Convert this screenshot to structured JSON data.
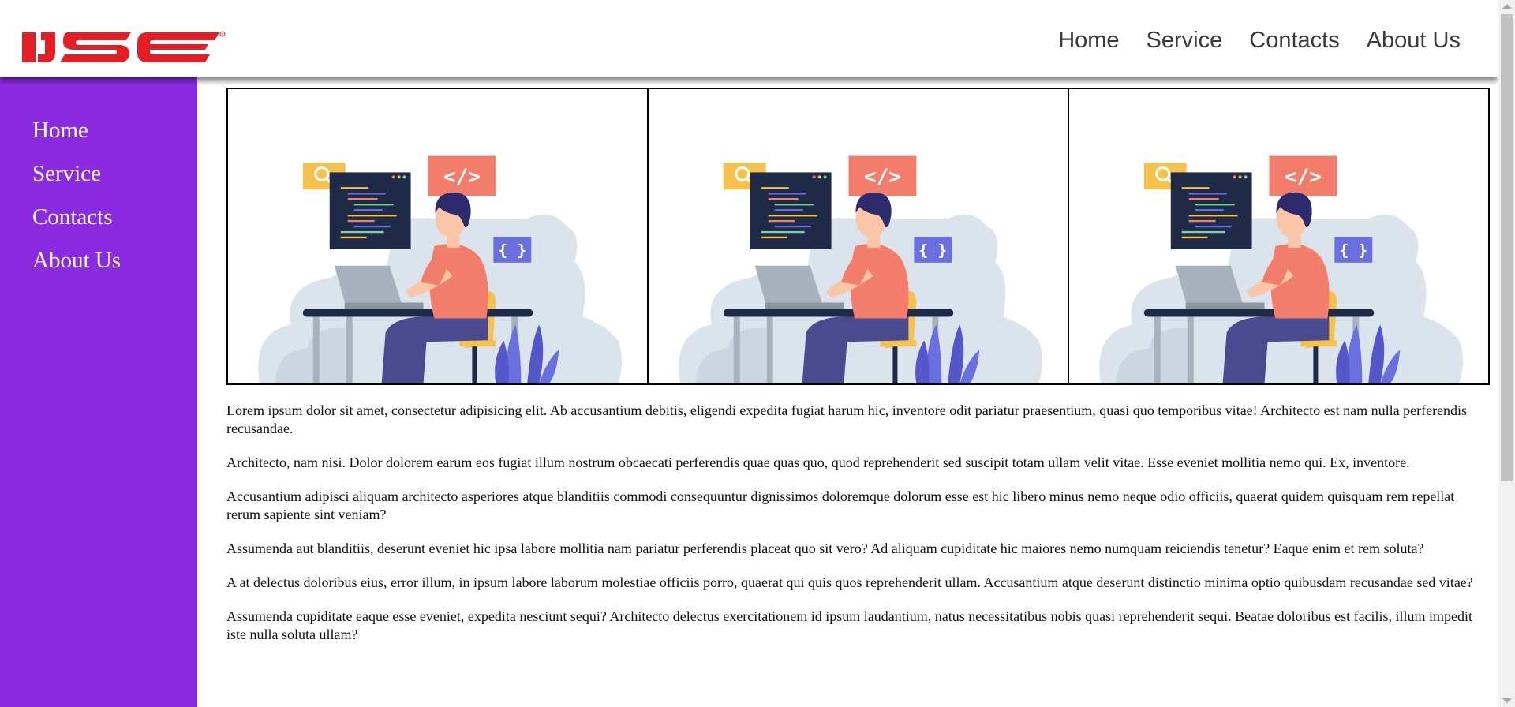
{
  "brand": {
    "logo_text": "IJSE"
  },
  "topnav": {
    "items": [
      {
        "label": "Home"
      },
      {
        "label": "Service"
      },
      {
        "label": "Contacts"
      },
      {
        "label": "About Us"
      }
    ]
  },
  "sidebar": {
    "items": [
      {
        "label": "Home"
      },
      {
        "label": "Service"
      },
      {
        "label": "Contacts"
      },
      {
        "label": "About Us"
      }
    ]
  },
  "gallery": {
    "images": [
      {
        "icon": "developer-illustration"
      },
      {
        "icon": "developer-illustration"
      },
      {
        "icon": "developer-illustration"
      }
    ]
  },
  "content": {
    "paragraphs": [
      "Lorem ipsum dolor sit amet, consectetur adipisicing elit. Ab accusantium debitis, eligendi expedita fugiat harum hic, inventore odit pariatur praesentium, quasi quo temporibus vitae! Architecto est nam nulla perferendis recusandae.",
      "Architecto, nam nisi. Dolor dolorem earum eos fugiat illum nostrum obcaecati perferendis quae quas quo, quod reprehenderit sed suscipit totam ullam velit vitae. Esse eveniet mollitia nemo qui. Ex, inventore.",
      "Accusantium adipisci aliquam architecto asperiores atque blanditiis commodi consequuntur dignissimos doloremque dolorum esse est hic libero minus nemo neque odio officiis, quaerat quidem quisquam rem repellat rerum sapiente sint veniam?",
      "Assumenda aut blanditiis, deserunt eveniet hic ipsa labore mollitia nam pariatur perferendis placeat quo sit vero? Ad aliquam cupiditate hic maiores nemo numquam reiciendis tenetur? Eaque enim et rem soluta?",
      "A at delectus doloribus eius, error illum, in ipsum labore laborum molestiae officiis porro, quaerat qui quis quos reprehenderit ullam. Accusantium atque deserunt distinctio minima optio quibusdam recusandae sed vitae?",
      "Assumenda cupiditate eaque esse eveniet, expedita nesciunt sequi? Architecto delectus exercitationem id ipsum laudantium, natus necessitatibus nobis quasi reprehenderit sequi. Beatae doloribus est facilis, illum impedit iste nulla soluta ullam?"
    ]
  },
  "colors": {
    "sidebar_bg": "#8a2be2",
    "logo_red": "#e31e24",
    "nav_text": "#3a3a3a"
  }
}
